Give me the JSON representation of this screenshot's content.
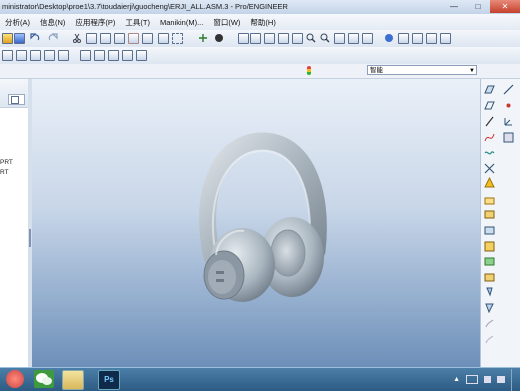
{
  "window": {
    "title": "ministrator\\Desktop\\proe1\\3.7\\toudaierji\\guocheng\\ERJI_ALL.ASM.3 - Pro/ENGINEER",
    "controls": [
      "minimize-icon",
      "maximize-icon",
      "close-icon"
    ]
  },
  "menubar": {
    "items": [
      "分析(A)",
      "信息(N)",
      "应用程序(P)",
      "工具(T)",
      "Manikin(M)...",
      "窗口(W)",
      "帮助(H)"
    ]
  },
  "filter": {
    "value": "智能"
  },
  "left_panel": {
    "tree_labels": [
      "PRT",
      "RT"
    ]
  },
  "viewport": {
    "model": "headphones-assembly"
  },
  "taskbar": {
    "apps": [
      "wechat-icon",
      "file-explorer-icon",
      "photoshop-icon"
    ],
    "photoshop_label": "Ps"
  },
  "colors": {
    "title_bar": "#c3d3e8",
    "viewport_top": "#eaf0f8",
    "viewport_bottom": "#6d8fb8",
    "taskbar": "#2d5b83",
    "close_button": "#c4412c"
  }
}
